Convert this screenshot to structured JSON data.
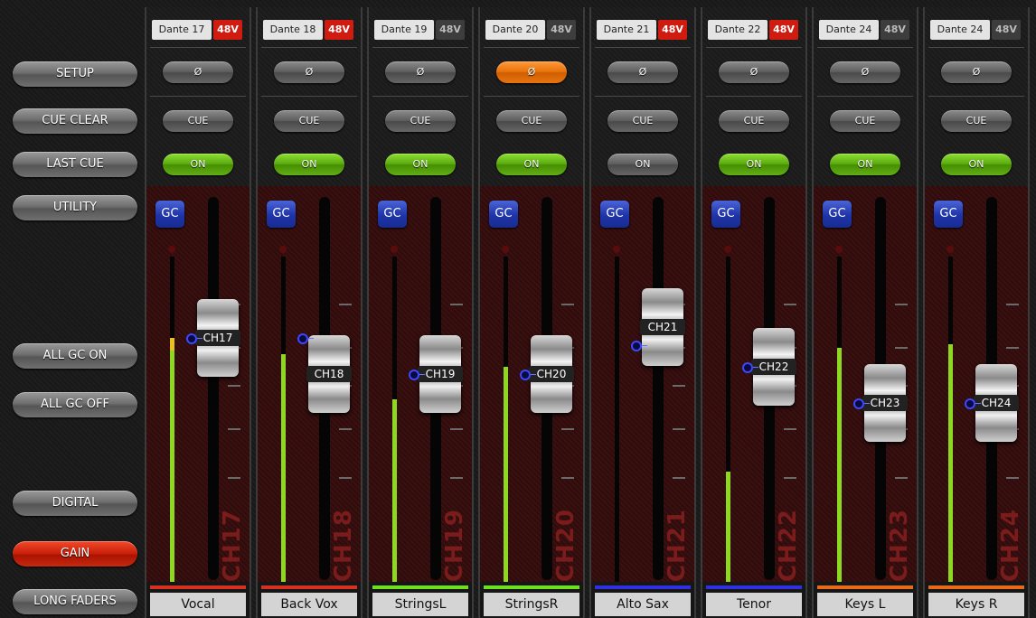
{
  "sidebar": {
    "buttons": [
      {
        "label": "SETUP",
        "active": false
      },
      {
        "label": "CUE CLEAR",
        "active": false
      },
      {
        "label": "LAST CUE",
        "active": false
      },
      {
        "label": "UTILITY",
        "active": false
      },
      {
        "label": "ALL GC ON",
        "active": false
      },
      {
        "label": "ALL GC OFF",
        "active": false
      },
      {
        "label": "DIGITAL",
        "active": false
      },
      {
        "label": "GAIN",
        "active": true
      },
      {
        "label": "LONG FADERS",
        "active": false
      }
    ]
  },
  "channels": [
    {
      "dante": "Dante 17",
      "p48": "48V",
      "p48_on": true,
      "phase": "Ø",
      "phase_on": false,
      "cue": "CUE",
      "on": "ON",
      "on_lit": true,
      "gc": "GC",
      "fader_label": "CH17",
      "big": "CH17",
      "name": "Vocal",
      "color": "#d83020",
      "meter": 0.74,
      "peak": 0.75,
      "knob": 0.37,
      "dot": 0.37
    },
    {
      "dante": "Dante 18",
      "p48": "48V",
      "p48_on": true,
      "phase": "Ø",
      "phase_on": false,
      "cue": "CUE",
      "on": "ON",
      "on_lit": true,
      "gc": "GC",
      "fader_label": "CH18",
      "big": "CH18",
      "name": "Back Vox",
      "color": "#d83020",
      "meter": 0.7,
      "peak": null,
      "knob": 0.47,
      "dot": 0.37
    },
    {
      "dante": "Dante 19",
      "p48": "48V",
      "p48_on": false,
      "phase": "Ø",
      "phase_on": false,
      "cue": "CUE",
      "on": "ON",
      "on_lit": true,
      "gc": "GC",
      "fader_label": "CH19",
      "big": "CH19",
      "name": "StringsL",
      "color": "#6ee020",
      "meter": 0.56,
      "peak": null,
      "knob": 0.47,
      "dot": 0.47
    },
    {
      "dante": "Dante 20",
      "p48": "48V",
      "p48_on": false,
      "phase": "Ø",
      "phase_on": true,
      "cue": "CUE",
      "on": "ON",
      "on_lit": true,
      "gc": "GC",
      "fader_label": "CH20",
      "big": "CH20",
      "name": "StringsR",
      "color": "#6ee020",
      "meter": 0.66,
      "peak": null,
      "knob": 0.47,
      "dot": 0.47
    },
    {
      "dante": "Dante 21",
      "p48": "48V",
      "p48_on": true,
      "phase": "Ø",
      "phase_on": false,
      "cue": "CUE",
      "on": "ON",
      "on_lit": false,
      "gc": "GC",
      "fader_label": "CH21",
      "big": "CH21",
      "name": "Alto Sax",
      "color": "#3030e0",
      "meter": 0.0,
      "peak": null,
      "knob": 0.34,
      "dot": 0.39
    },
    {
      "dante": "Dante 22",
      "p48": "48V",
      "p48_on": true,
      "phase": "Ø",
      "phase_on": false,
      "cue": "CUE",
      "on": "ON",
      "on_lit": true,
      "gc": "GC",
      "fader_label": "CH22",
      "big": "CH22",
      "name": "Tenor",
      "color": "#3030e0",
      "meter": 0.34,
      "peak": null,
      "knob": 0.45,
      "dot": 0.45
    },
    {
      "dante": "Dante 24",
      "p48": "48V",
      "p48_on": false,
      "phase": "Ø",
      "phase_on": false,
      "cue": "CUE",
      "on": "ON",
      "on_lit": true,
      "gc": "GC",
      "fader_label": "CH23",
      "big": "CH23",
      "name": "Keys L",
      "color": "#e86a18",
      "meter": 0.72,
      "peak": null,
      "knob": 0.55,
      "dot": 0.55
    },
    {
      "dante": "Dante 24",
      "p48": "48V",
      "p48_on": false,
      "phase": "Ø",
      "phase_on": false,
      "cue": "CUE",
      "on": "ON",
      "on_lit": true,
      "gc": "GC",
      "fader_label": "CH24",
      "big": "CH24",
      "name": "Keys R",
      "color": "#e86a18",
      "meter": 0.73,
      "peak": null,
      "knob": 0.55,
      "dot": 0.55
    }
  ]
}
